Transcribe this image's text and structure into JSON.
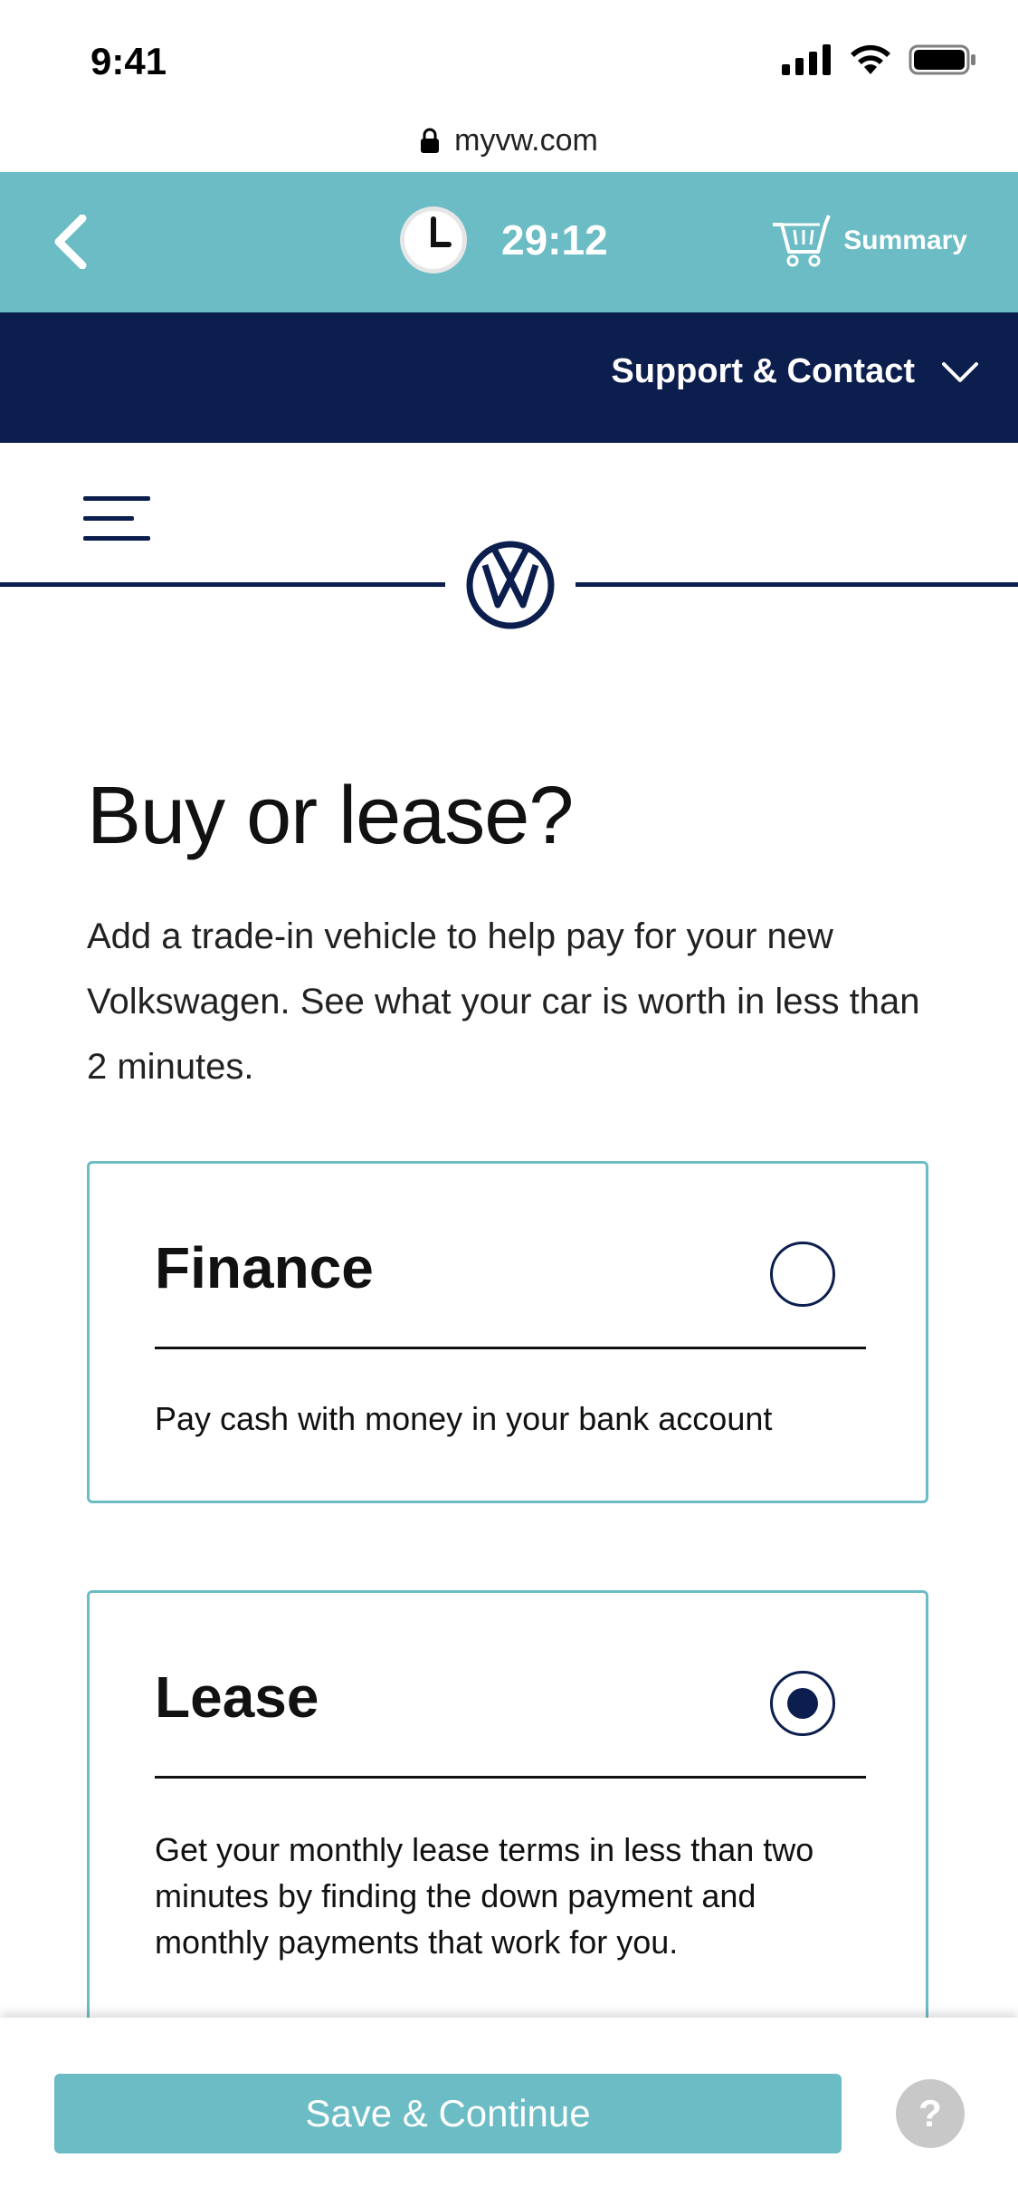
{
  "status_bar": {
    "time": "9:41"
  },
  "browser": {
    "url": "myvw.com"
  },
  "timer_bar": {
    "timer": "29:12",
    "summary_label": "Summary"
  },
  "support": {
    "label": "Support & Contact"
  },
  "main": {
    "title": "Buy or lease?",
    "description": "Add a trade-in vehicle to help pay for your new Volkswagen. See what your car is worth in less than 2 minutes."
  },
  "options": [
    {
      "title": "Finance",
      "description": "Pay cash with money in your bank account",
      "selected": false
    },
    {
      "title": "Lease",
      "description": "Get your monthly lease terms in less than two minutes by finding the down payment and monthly payments that work for you.",
      "selected": true
    }
  ],
  "footer": {
    "save_label": "Save & Continue",
    "help_label": "?"
  },
  "colors": {
    "teal": "#6bbcc5",
    "navy": "#0b1e4d",
    "disabled_grey": "#c8c8c8"
  }
}
